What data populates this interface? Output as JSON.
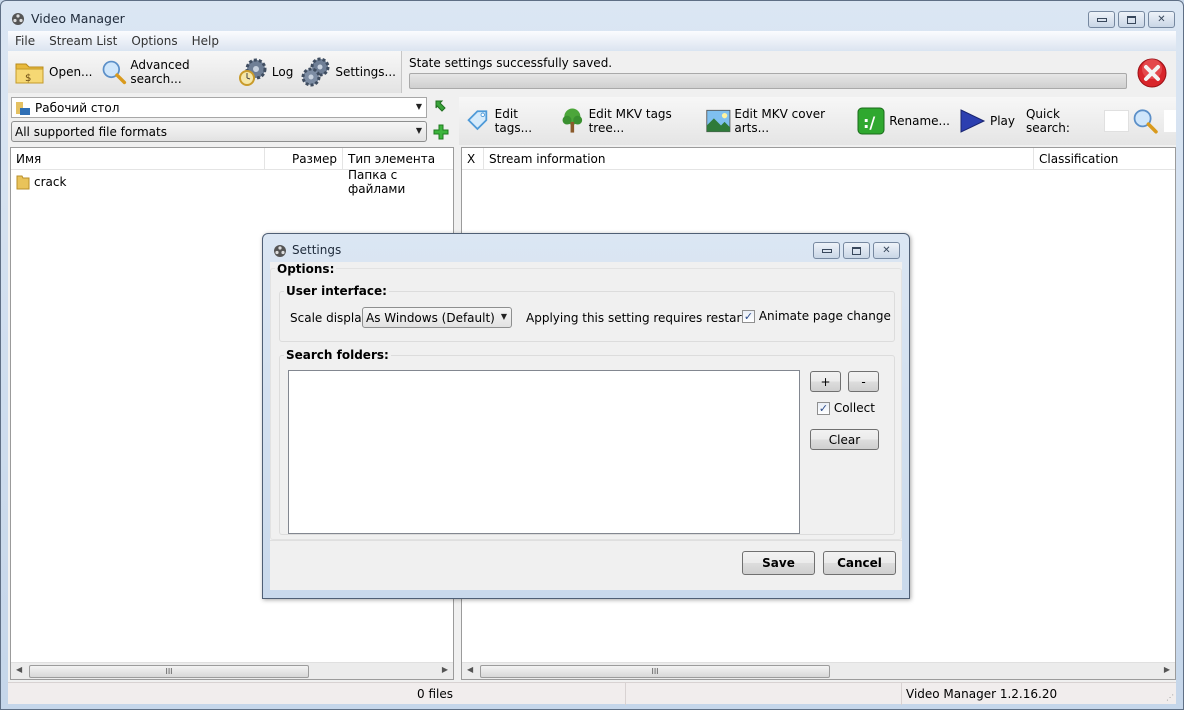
{
  "window": {
    "title": "Video Manager",
    "controls": {
      "minimize": "▭",
      "maximize": "▢",
      "close": "✕"
    }
  },
  "menu": [
    "File",
    "Stream List",
    "Options",
    "Help"
  ],
  "toolbar": {
    "open": "Open...",
    "advanced_search": "Advanced search...",
    "log": "Log",
    "settings": "Settings..."
  },
  "status": {
    "message": "State settings successfully saved.",
    "progress_percent": 0
  },
  "left_pane": {
    "location": "Рабочий стол",
    "filter": "All supported file formats",
    "columns": [
      "Имя",
      "Размер",
      "Тип элемента"
    ],
    "rows": [
      {
        "name": "crack",
        "size": "",
        "type": "Папка с файлами"
      }
    ],
    "scroll_grip": "III"
  },
  "right_pane": {
    "toolbar": {
      "edit_tags": "Edit tags...",
      "edit_mkv_tags_tree": "Edit MKV tags tree...",
      "edit_mkv_cover_arts": "Edit MKV cover arts...",
      "rename": "Rename...",
      "play": "Play",
      "quick_search_label": "Quick search:",
      "quick_search_value": ""
    },
    "columns": [
      "X",
      "Stream information",
      "Classification"
    ],
    "scroll_grip": "III"
  },
  "statusbar": {
    "files": "0 files",
    "version": "Video Manager 1.2.16.20"
  },
  "dialog": {
    "title": "Settings",
    "options_label": "Options:",
    "user_interface": {
      "label": "User interface:",
      "scale_label": "Scale display:",
      "scale_value": "As Windows (Default)",
      "restart_note": "Applying this setting requires restart.",
      "animate_label": "Animate page change",
      "animate_checked": true
    },
    "search_folders": {
      "label": "Search folders:",
      "items": [],
      "add": "+",
      "remove": "-",
      "collect_label": "Collect",
      "collect_checked": true,
      "clear": "Clear"
    },
    "save": "Save",
    "cancel": "Cancel"
  },
  "colors": {
    "title_bar": "#c9d8ea",
    "client_bg": "#f0f0f0",
    "statusbar_bg": "#f1eded",
    "error_red": "#d9252b"
  }
}
